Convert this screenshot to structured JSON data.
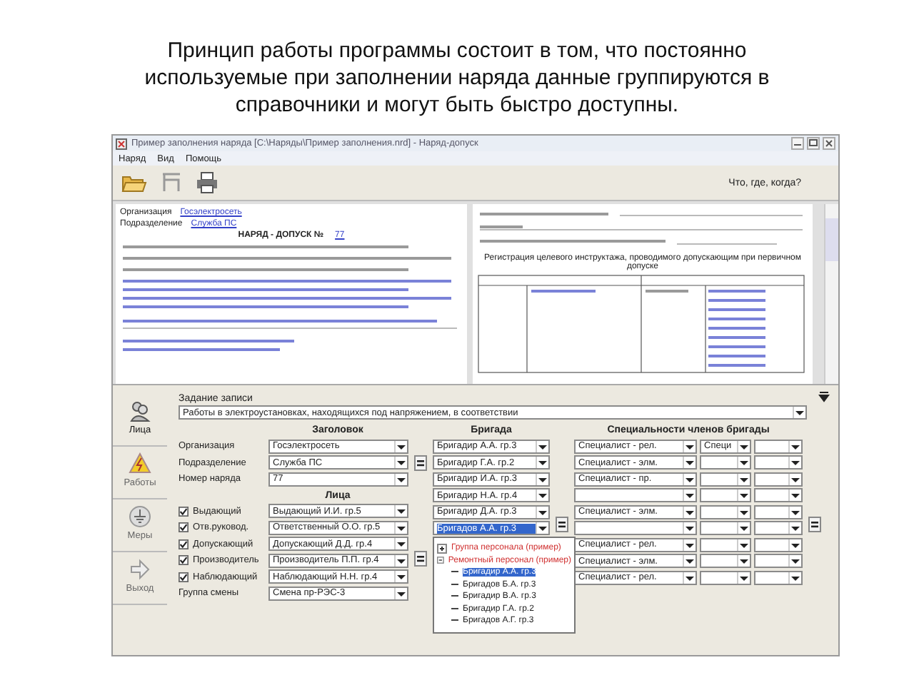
{
  "slide_title": "Принцип работы программы состоит в том, что постоянно используемые при заполнении наряда данные группируются в справочники и могут быть быстро доступны.",
  "window": {
    "title": "Пример заполнения наряда [C:\\Наряды\\Пример заполнения.nrd] - Наряд-допуск",
    "menu": [
      "Наряд",
      "Вид",
      "Помощь"
    ],
    "toolbar_hint": "Что, где, когда?"
  },
  "preview": {
    "document_title": "НАРЯД - ДОПУСК №",
    "number": "77",
    "org_label": "Организация",
    "org_value": "Госэлектросеть",
    "dept_label": "Подразделение",
    "dept_value": "Служба ПС",
    "briefing_title": "Регистрация целевого инструктажа, проводимого допускающим при первичном допуске"
  },
  "sidebar": [
    {
      "label": "Лица",
      "selected": true
    },
    {
      "label": "Работы",
      "selected": false
    },
    {
      "label": "Меры",
      "selected": false
    },
    {
      "label": "Выход",
      "selected": false
    }
  ],
  "task": {
    "label": "Задание записи",
    "value": "Работы в электроустановках, находящихся под напряжением, в соответствии"
  },
  "header": {
    "title": "Заголовок",
    "fields": [
      {
        "label": "Организация",
        "value": "Госэлектросеть"
      },
      {
        "label": "Подразделение",
        "value": "Служба ПС"
      },
      {
        "label": "Номер наряда",
        "value": "77"
      }
    ]
  },
  "persons": {
    "title": "Лица",
    "fields": [
      {
        "kind": "checkbox",
        "label": "Выдающий",
        "checked": true,
        "value": "Выдающий И.И. гр.5"
      },
      {
        "kind": "checkbox",
        "label": "Отв.руковод.",
        "checked": true,
        "value": "Ответственный О.О. гр.5"
      },
      {
        "kind": "checkbox",
        "label": "Допускающий",
        "checked": true,
        "value": "Допускающий Д.Д. гр.4"
      },
      {
        "kind": "checkbox",
        "label": "Производитель",
        "checked": true,
        "value": "Производитель П.П. гр.4"
      },
      {
        "kind": "checkbox",
        "label": "Наблюдающий",
        "checked": true,
        "value": "Наблюдающий Н.Н. гр.4"
      },
      {
        "kind": "plain",
        "label": "Группа смены",
        "value": "Смена пр-РЭС-3"
      }
    ]
  },
  "brigade": {
    "title": "Бригада",
    "members": [
      {
        "value": "Бригадир А.А. гр.3",
        "selected": false
      },
      {
        "value": "Бригадир Г.А. гр.2",
        "selected": false
      },
      {
        "value": "Бригадир И.А. гр.3",
        "selected": false
      },
      {
        "value": "Бригадир Н.А. гр.4",
        "selected": false
      },
      {
        "value": "Бригадир Д.А. гр.3",
        "selected": false
      },
      {
        "value": "Бригадов А.А. гр.3",
        "selected": true
      }
    ]
  },
  "dropdown": {
    "items": [
      {
        "label": "Группа персонала (пример)",
        "expanded": false
      },
      {
        "label": "Ремонтный персонал (пример)",
        "expanded": true,
        "children": [
          {
            "label": "Бригадир А.А. гр.3",
            "selected": true
          },
          {
            "label": "Бригадов Б.А. гр.3",
            "selected": false
          },
          {
            "label": "Бригадир В.А. гр.3",
            "selected": false
          },
          {
            "label": "Бригадир Г.А. гр.2",
            "selected": false
          },
          {
            "label": "Бригадов А.Г. гр.3",
            "selected": false
          }
        ]
      }
    ]
  },
  "specialties": {
    "title": "Специальности членов бригады",
    "rows": [
      [
        "Специалист - рел.",
        "Специ",
        ""
      ],
      [
        "Специалист - элм.",
        "",
        ""
      ],
      [
        "Специалист - пр.",
        "",
        ""
      ],
      [
        "",
        "",
        ""
      ],
      [
        "Специалист - элм.",
        "",
        ""
      ],
      [
        "",
        "",
        ""
      ],
      [
        "Специалист - рел.",
        "",
        ""
      ],
      [
        "Специалист - элм.",
        "",
        ""
      ],
      [
        "Специалист - рел.",
        "",
        ""
      ]
    ]
  }
}
